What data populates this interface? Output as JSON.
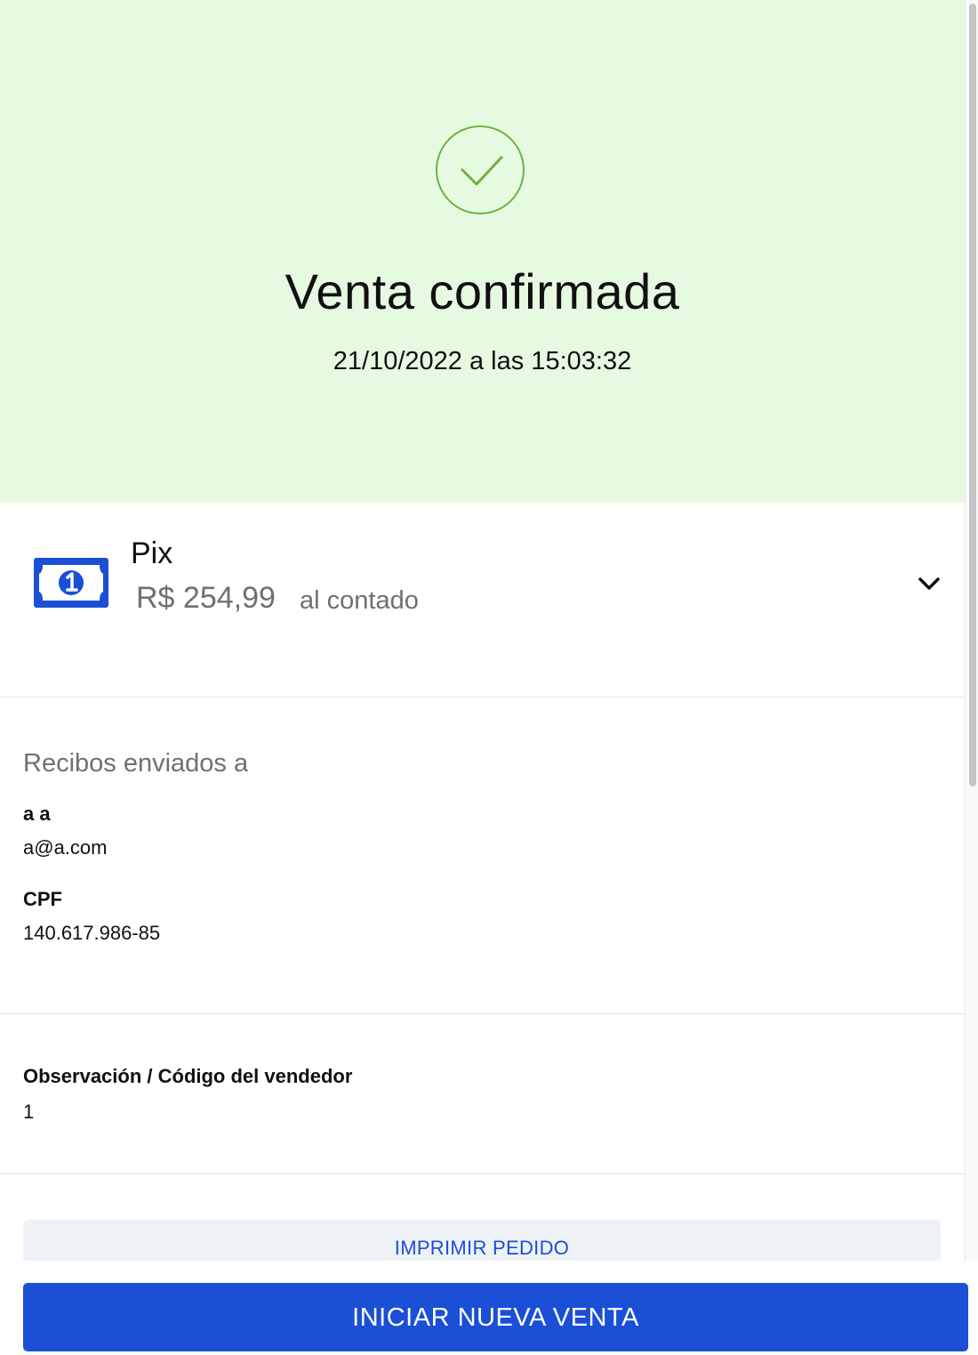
{
  "header": {
    "title": "Venta confirmada",
    "datetime": "21/10/2022 a las 15:03:32"
  },
  "payment": {
    "method": "Pix",
    "amount": "R$ 254,99",
    "terms": "al contado",
    "icon": "banknote-icon"
  },
  "receipts": {
    "heading": "Recibos enviados a",
    "name": "a a",
    "email": "a@a.com",
    "doc_label": "CPF",
    "doc_value": "140.617.986-85"
  },
  "observation": {
    "label": "Observación / Código del vendedor",
    "value": "1"
  },
  "actions": {
    "print_label": "IMPRIMIR PEDIDO",
    "new_sale_label": "INICIAR NUEVA VENTA"
  },
  "colors": {
    "success_bg": "#e6fae2",
    "success_accent": "#6fb23f",
    "primary": "#1a4fd6"
  }
}
